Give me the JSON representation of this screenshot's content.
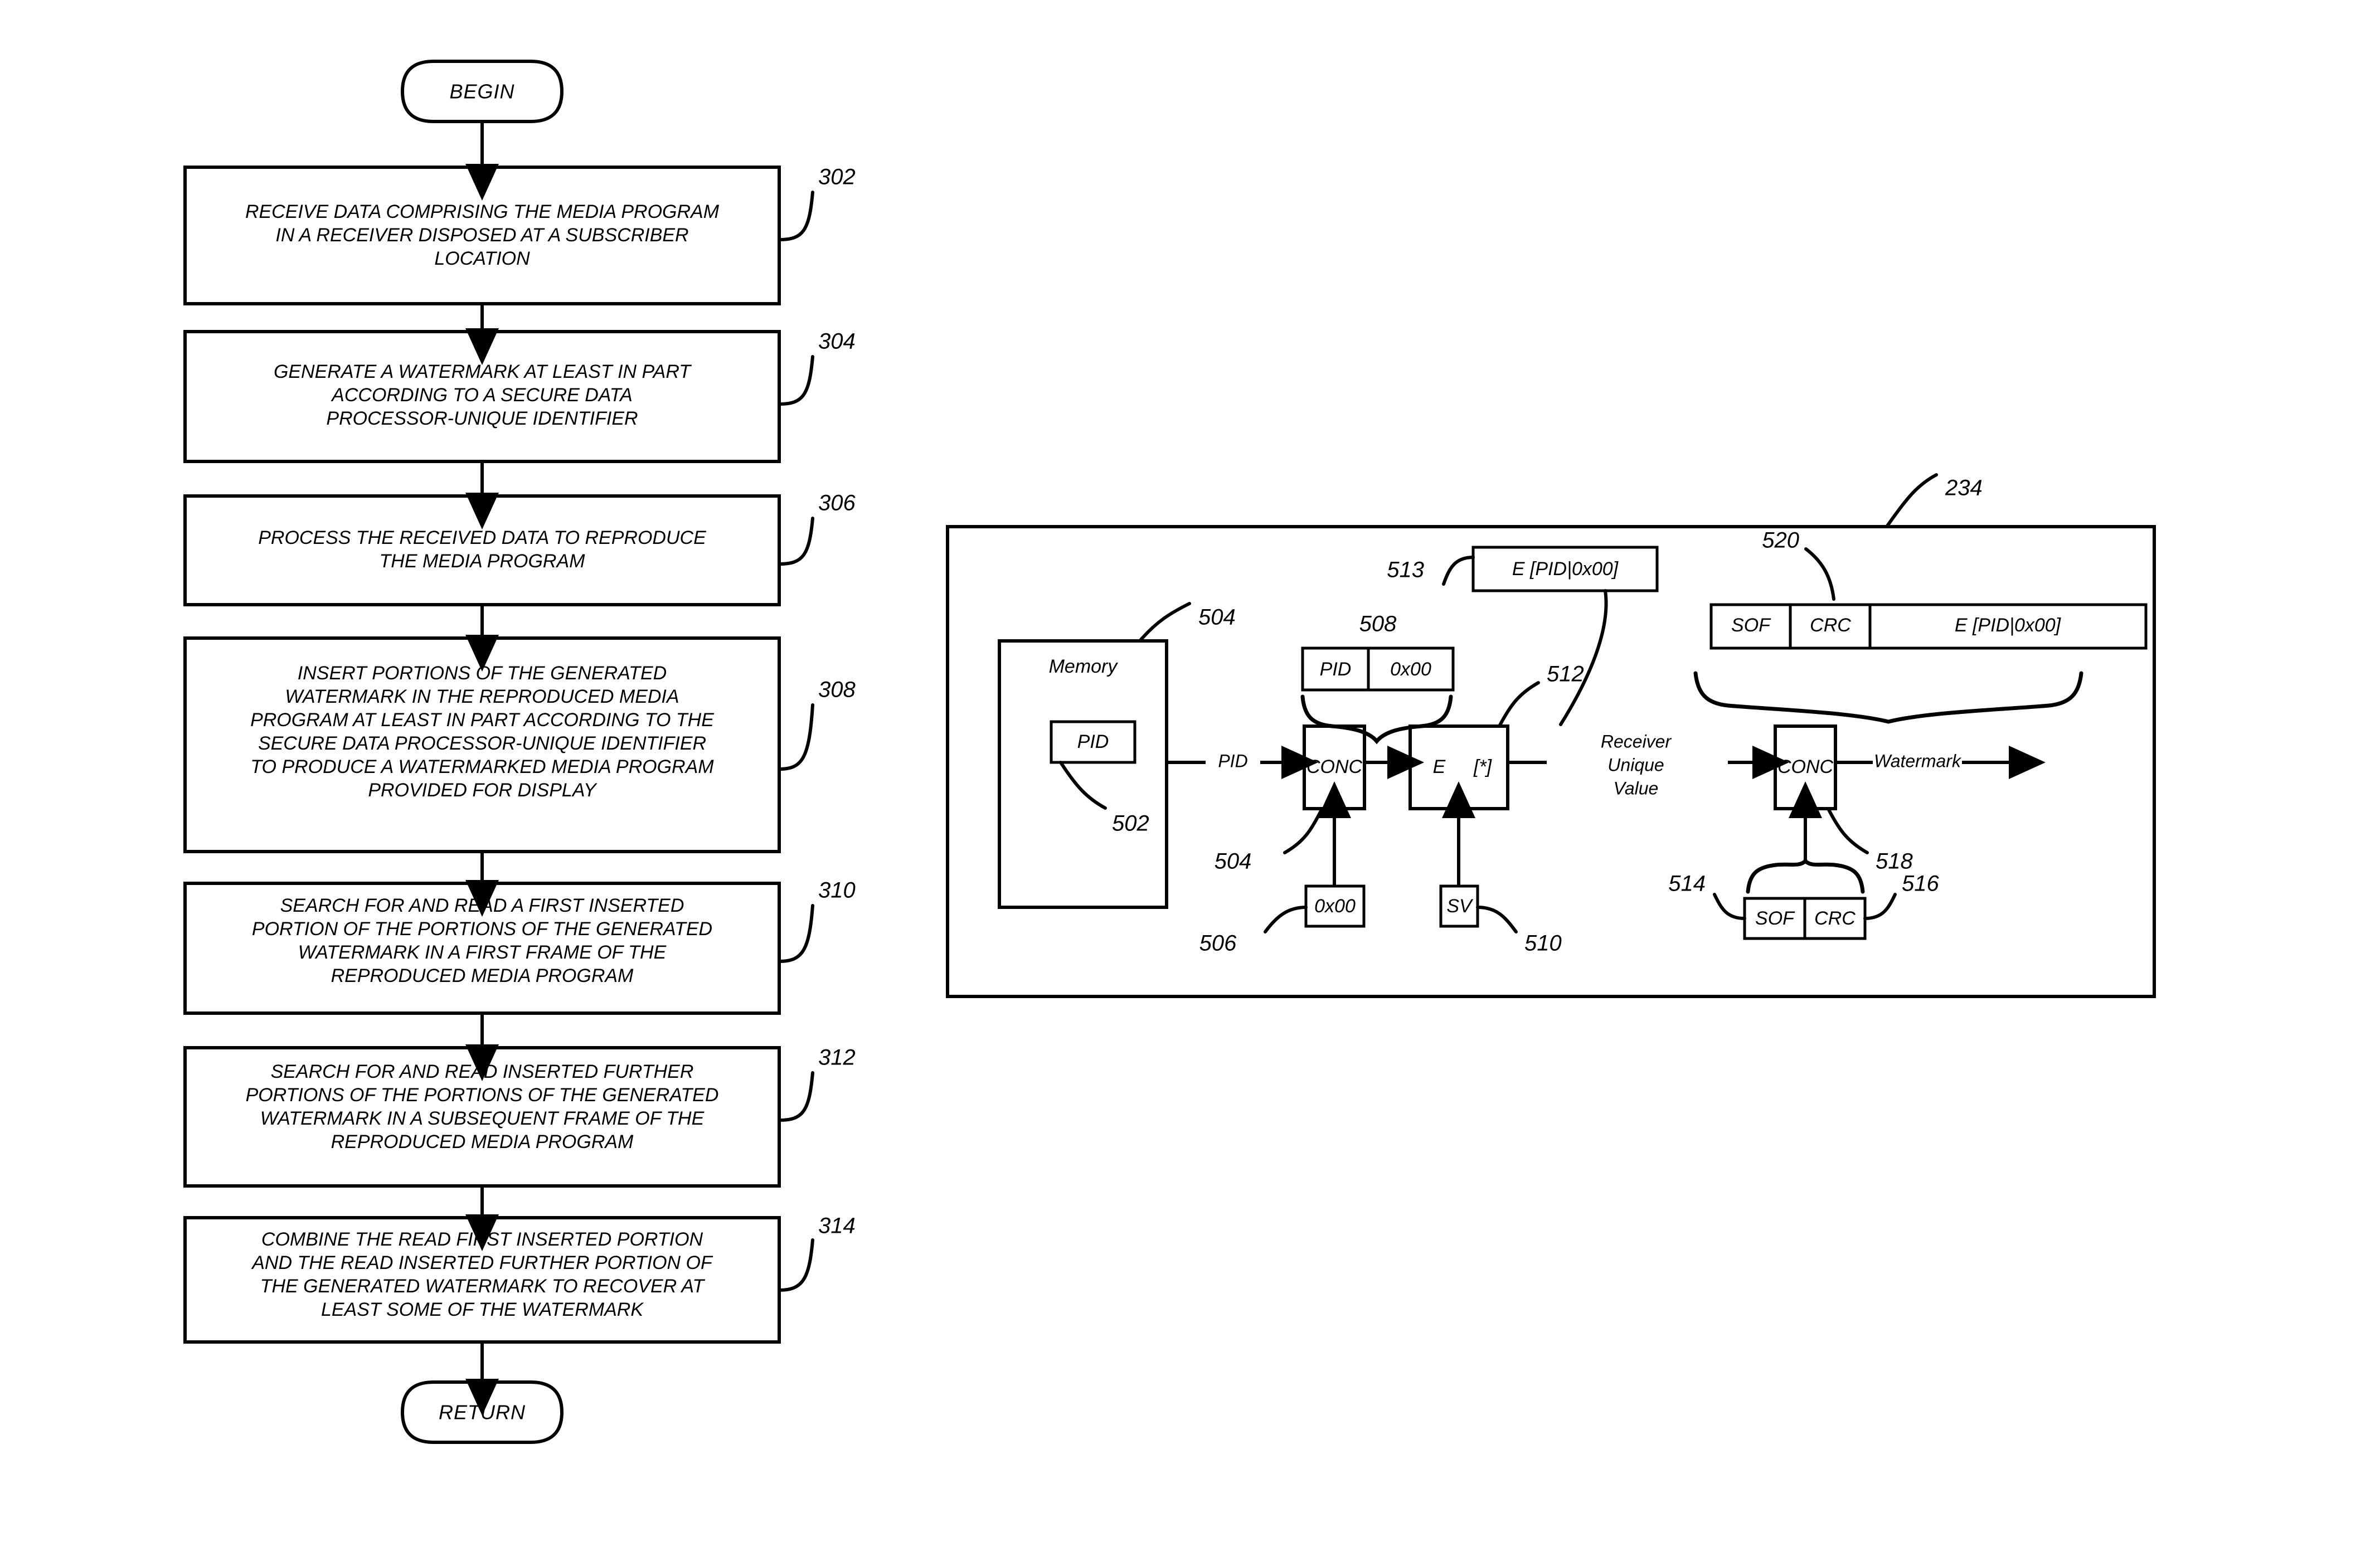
{
  "figure": {
    "type": "patent-flowchart-and-block-diagram",
    "background": "#ffffff",
    "ink": "#000000"
  },
  "flowchart": {
    "start_terminator": {
      "label": "BEGIN"
    },
    "end_terminator": {
      "label": "RETURN"
    },
    "steps": [
      {
        "ref": "302",
        "lines": [
          "RECEIVE DATA COMPRISING THE MEDIA PROGRAM",
          "IN A RECEIVER DISPOSED AT A SUBSCRIBER",
          "LOCATION"
        ]
      },
      {
        "ref": "304",
        "lines": [
          "GENERATE A WATERMARK AT LEAST IN PART",
          "ACCORDING TO A SECURE DATA",
          "PROCESSOR-UNIQUE IDENTIFIER"
        ]
      },
      {
        "ref": "306",
        "lines": [
          "PROCESS THE RECEIVED DATA TO REPRODUCE",
          "THE MEDIA PROGRAM"
        ]
      },
      {
        "ref": "308",
        "lines": [
          "INSERT PORTIONS OF THE GENERATED",
          "WATERMARK IN THE REPRODUCED MEDIA",
          "PROGRAM AT LEAST IN PART ACCORDING TO THE",
          "SECURE DATA PROCESSOR-UNIQUE IDENTIFIER",
          "TO PRODUCE A WATERMARKED MEDIA PROGRAM",
          "PROVIDED FOR DISPLAY"
        ]
      },
      {
        "ref": "310",
        "lines": [
          "SEARCH FOR AND READ A FIRST INSERTED",
          "PORTION OF THE PORTIONS OF THE GENERATED",
          "WATERMARK IN A FIRST FRAME OF THE",
          "REPRODUCED MEDIA PROGRAM"
        ]
      },
      {
        "ref": "312",
        "lines": [
          "SEARCH FOR AND READ INSERTED FURTHER",
          "PORTIONS OF THE PORTIONS OF THE GENERATED",
          "WATERMARK IN A SUBSEQUENT FRAME OF THE",
          "REPRODUCED MEDIA PROGRAM"
        ]
      },
      {
        "ref": "314",
        "lines": [
          "COMBINE THE READ FIRST INSERTED PORTION",
          "AND THE READ INSERTED FURTHER PORTION OF",
          "THE GENERATED WATERMARK TO RECOVER AT",
          "LEAST SOME OF THE WATERMARK"
        ]
      }
    ]
  },
  "block_diagram": {
    "enclosure_ref": "234",
    "memory": {
      "ref": "504",
      "label": "Memory",
      "contents": {
        "ref": "502",
        "label": "PID"
      }
    },
    "signals": {
      "pid_out": "PID",
      "receiver_unique_value": [
        "Receiver",
        "Unique",
        "Value"
      ],
      "watermark_out": "Watermark"
    },
    "concat_1": {
      "ref": "504",
      "label": "CONC"
    },
    "constant_zero": {
      "ref": "506",
      "label": "0x00"
    },
    "concat_1_result": {
      "ref": "508",
      "cells": [
        "PID",
        "0x00"
      ]
    },
    "encrypt": {
      "ref": "512",
      "label_left": "E",
      "label_right": "[*]"
    },
    "secret_value": {
      "ref": "510",
      "label": "SV"
    },
    "encrypt_result": {
      "ref": "513",
      "label": "E   [PID|0x00]"
    },
    "concat_2": {
      "ref": "518",
      "label": "CONC"
    },
    "header_fields": {
      "refs": [
        "514",
        "516"
      ],
      "cells": [
        "SOF",
        "CRC"
      ]
    },
    "watermark_frame": {
      "ref": "520",
      "cells": [
        "SOF",
        "CRC",
        "E   [PID|0x00]"
      ]
    }
  }
}
